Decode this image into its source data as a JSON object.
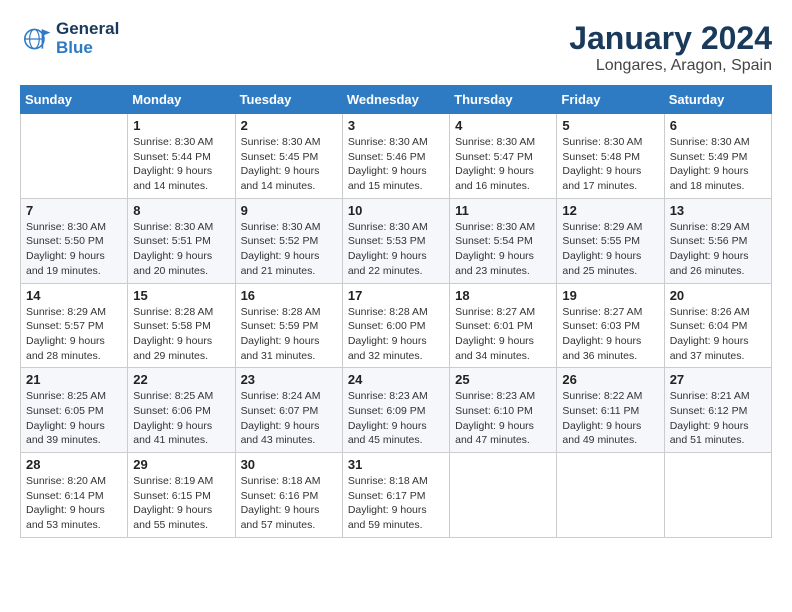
{
  "header": {
    "logo_line1": "General",
    "logo_line2": "Blue",
    "title": "January 2024",
    "subtitle": "Longares, Aragon, Spain"
  },
  "weekdays": [
    "Sunday",
    "Monday",
    "Tuesday",
    "Wednesday",
    "Thursday",
    "Friday",
    "Saturday"
  ],
  "weeks": [
    [
      {
        "day": "",
        "sunrise": "",
        "sunset": "",
        "daylight": ""
      },
      {
        "day": "1",
        "sunrise": "Sunrise: 8:30 AM",
        "sunset": "Sunset: 5:44 PM",
        "daylight": "Daylight: 9 hours and 14 minutes."
      },
      {
        "day": "2",
        "sunrise": "Sunrise: 8:30 AM",
        "sunset": "Sunset: 5:45 PM",
        "daylight": "Daylight: 9 hours and 14 minutes."
      },
      {
        "day": "3",
        "sunrise": "Sunrise: 8:30 AM",
        "sunset": "Sunset: 5:46 PM",
        "daylight": "Daylight: 9 hours and 15 minutes."
      },
      {
        "day": "4",
        "sunrise": "Sunrise: 8:30 AM",
        "sunset": "Sunset: 5:47 PM",
        "daylight": "Daylight: 9 hours and 16 minutes."
      },
      {
        "day": "5",
        "sunrise": "Sunrise: 8:30 AM",
        "sunset": "Sunset: 5:48 PM",
        "daylight": "Daylight: 9 hours and 17 minutes."
      },
      {
        "day": "6",
        "sunrise": "Sunrise: 8:30 AM",
        "sunset": "Sunset: 5:49 PM",
        "daylight": "Daylight: 9 hours and 18 minutes."
      }
    ],
    [
      {
        "day": "7",
        "sunrise": "Sunrise: 8:30 AM",
        "sunset": "Sunset: 5:50 PM",
        "daylight": "Daylight: 9 hours and 19 minutes."
      },
      {
        "day": "8",
        "sunrise": "Sunrise: 8:30 AM",
        "sunset": "Sunset: 5:51 PM",
        "daylight": "Daylight: 9 hours and 20 minutes."
      },
      {
        "day": "9",
        "sunrise": "Sunrise: 8:30 AM",
        "sunset": "Sunset: 5:52 PM",
        "daylight": "Daylight: 9 hours and 21 minutes."
      },
      {
        "day": "10",
        "sunrise": "Sunrise: 8:30 AM",
        "sunset": "Sunset: 5:53 PM",
        "daylight": "Daylight: 9 hours and 22 minutes."
      },
      {
        "day": "11",
        "sunrise": "Sunrise: 8:30 AM",
        "sunset": "Sunset: 5:54 PM",
        "daylight": "Daylight: 9 hours and 23 minutes."
      },
      {
        "day": "12",
        "sunrise": "Sunrise: 8:29 AM",
        "sunset": "Sunset: 5:55 PM",
        "daylight": "Daylight: 9 hours and 25 minutes."
      },
      {
        "day": "13",
        "sunrise": "Sunrise: 8:29 AM",
        "sunset": "Sunset: 5:56 PM",
        "daylight": "Daylight: 9 hours and 26 minutes."
      }
    ],
    [
      {
        "day": "14",
        "sunrise": "Sunrise: 8:29 AM",
        "sunset": "Sunset: 5:57 PM",
        "daylight": "Daylight: 9 hours and 28 minutes."
      },
      {
        "day": "15",
        "sunrise": "Sunrise: 8:28 AM",
        "sunset": "Sunset: 5:58 PM",
        "daylight": "Daylight: 9 hours and 29 minutes."
      },
      {
        "day": "16",
        "sunrise": "Sunrise: 8:28 AM",
        "sunset": "Sunset: 5:59 PM",
        "daylight": "Daylight: 9 hours and 31 minutes."
      },
      {
        "day": "17",
        "sunrise": "Sunrise: 8:28 AM",
        "sunset": "Sunset: 6:00 PM",
        "daylight": "Daylight: 9 hours and 32 minutes."
      },
      {
        "day": "18",
        "sunrise": "Sunrise: 8:27 AM",
        "sunset": "Sunset: 6:01 PM",
        "daylight": "Daylight: 9 hours and 34 minutes."
      },
      {
        "day": "19",
        "sunrise": "Sunrise: 8:27 AM",
        "sunset": "Sunset: 6:03 PM",
        "daylight": "Daylight: 9 hours and 36 minutes."
      },
      {
        "day": "20",
        "sunrise": "Sunrise: 8:26 AM",
        "sunset": "Sunset: 6:04 PM",
        "daylight": "Daylight: 9 hours and 37 minutes."
      }
    ],
    [
      {
        "day": "21",
        "sunrise": "Sunrise: 8:25 AM",
        "sunset": "Sunset: 6:05 PM",
        "daylight": "Daylight: 9 hours and 39 minutes."
      },
      {
        "day": "22",
        "sunrise": "Sunrise: 8:25 AM",
        "sunset": "Sunset: 6:06 PM",
        "daylight": "Daylight: 9 hours and 41 minutes."
      },
      {
        "day": "23",
        "sunrise": "Sunrise: 8:24 AM",
        "sunset": "Sunset: 6:07 PM",
        "daylight": "Daylight: 9 hours and 43 minutes."
      },
      {
        "day": "24",
        "sunrise": "Sunrise: 8:23 AM",
        "sunset": "Sunset: 6:09 PM",
        "daylight": "Daylight: 9 hours and 45 minutes."
      },
      {
        "day": "25",
        "sunrise": "Sunrise: 8:23 AM",
        "sunset": "Sunset: 6:10 PM",
        "daylight": "Daylight: 9 hours and 47 minutes."
      },
      {
        "day": "26",
        "sunrise": "Sunrise: 8:22 AM",
        "sunset": "Sunset: 6:11 PM",
        "daylight": "Daylight: 9 hours and 49 minutes."
      },
      {
        "day": "27",
        "sunrise": "Sunrise: 8:21 AM",
        "sunset": "Sunset: 6:12 PM",
        "daylight": "Daylight: 9 hours and 51 minutes."
      }
    ],
    [
      {
        "day": "28",
        "sunrise": "Sunrise: 8:20 AM",
        "sunset": "Sunset: 6:14 PM",
        "daylight": "Daylight: 9 hours and 53 minutes."
      },
      {
        "day": "29",
        "sunrise": "Sunrise: 8:19 AM",
        "sunset": "Sunset: 6:15 PM",
        "daylight": "Daylight: 9 hours and 55 minutes."
      },
      {
        "day": "30",
        "sunrise": "Sunrise: 8:18 AM",
        "sunset": "Sunset: 6:16 PM",
        "daylight": "Daylight: 9 hours and 57 minutes."
      },
      {
        "day": "31",
        "sunrise": "Sunrise: 8:18 AM",
        "sunset": "Sunset: 6:17 PM",
        "daylight": "Daylight: 9 hours and 59 minutes."
      },
      {
        "day": "",
        "sunrise": "",
        "sunset": "",
        "daylight": ""
      },
      {
        "day": "",
        "sunrise": "",
        "sunset": "",
        "daylight": ""
      },
      {
        "day": "",
        "sunrise": "",
        "sunset": "",
        "daylight": ""
      }
    ]
  ]
}
